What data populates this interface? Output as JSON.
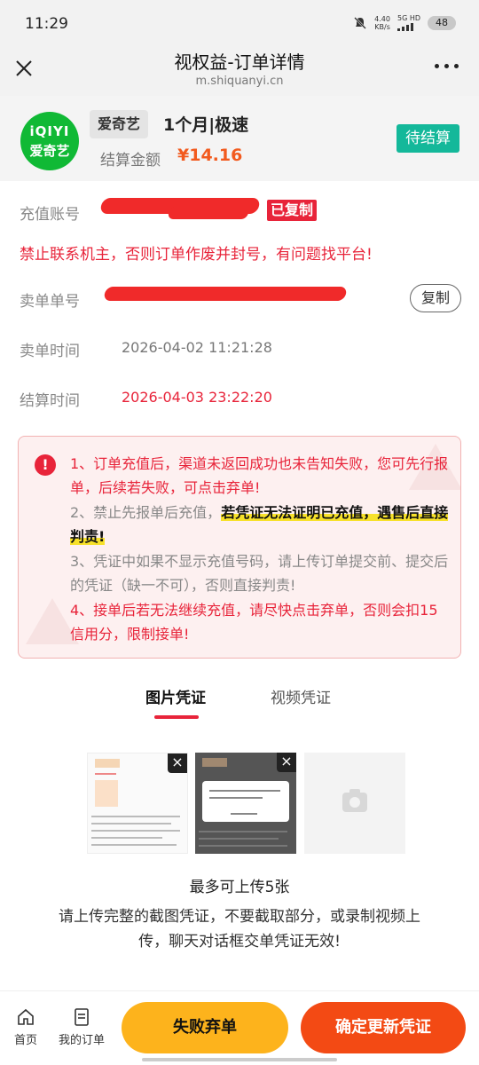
{
  "status_bar": {
    "time": "11:29",
    "net_speed_value": "4.40",
    "net_speed_unit": "KB/s",
    "network_type": "5G HD",
    "battery": "48",
    "icons": [
      "mute-bell-icon",
      "signal-icon",
      "battery-icon"
    ]
  },
  "header": {
    "title": "视权益-订单详情",
    "url": "m.shiquanyi.cn"
  },
  "product": {
    "logo_line1": "iQIYI",
    "logo_line2": "爱奇艺",
    "platform": "爱奇艺",
    "name": "1个月|极速",
    "settle_label": "结算金额",
    "settle_amount": "¥14.16",
    "status": "待结算"
  },
  "details": {
    "account_label": "充值账号",
    "copied_tag": "已复制",
    "warning": "禁止联系机主，否则订单作废并封号，有问题找平台!",
    "sell_order_label": "卖单单号",
    "copy_button": "复制",
    "sell_time_label": "卖单时间",
    "sell_time": "2026-04-02 11:21:28",
    "settle_time_label": "结算时间",
    "settle_time": "2026-04-03 23:22:20"
  },
  "notice": {
    "icon": "!",
    "item1": "1、订单充值后，渠道未返回成功也未告知失败，您可先行报单，后续若失败，可点击弃单!",
    "item2_prefix": "2、禁止先报单后充值，",
    "item2_highlight": "若凭证无法证明已充值，遇售后直接判责!",
    "item3": "3、凭证中如果不显示充值号码，请上传订单提交前、提交后的凭证（缺一不可），否则直接判责!",
    "item4": "4、接单后若无法继续充值，请尽快点击弃单，否则会扣15信用分，限制接单!"
  },
  "tabs": [
    {
      "label": "图片凭证",
      "active": true
    },
    {
      "label": "视频凭证",
      "active": false
    }
  ],
  "upload": {
    "limit": "最多可上传5张",
    "note": "请上传完整的截图凭证，不要截取部分，或录制视频上传，聊天对话框交单凭证无效!"
  },
  "bottom_nav": {
    "home": "首页",
    "my_orders": "我的订单",
    "fail_button": "失败弃单",
    "confirm_button": "确定更新凭证"
  },
  "colors": {
    "accent_red": "#e8243a",
    "price_orange": "#f25a1e",
    "status_teal": "#14b89a",
    "button_yellow": "#fdb31c",
    "button_orange": "#f34a14",
    "iqiyi_green": "#10b935"
  }
}
